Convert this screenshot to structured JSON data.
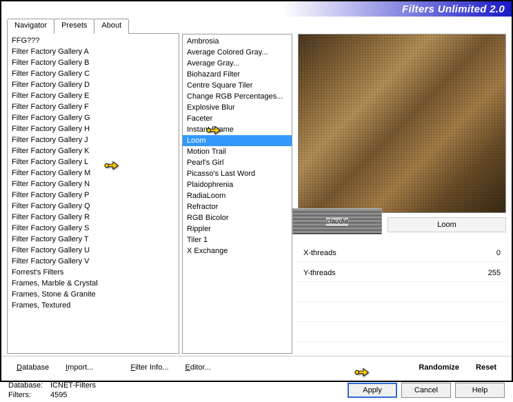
{
  "title": "Filters Unlimited 2.0",
  "tabs": [
    {
      "label": "Navigator",
      "active": true
    },
    {
      "label": "Presets",
      "active": false
    },
    {
      "label": "About",
      "active": false
    }
  ],
  "galleries": [
    "FFG???",
    "Filter Factory Gallery A",
    "Filter Factory Gallery B",
    "Filter Factory Gallery C",
    "Filter Factory Gallery D",
    "Filter Factory Gallery E",
    "Filter Factory Gallery F",
    "Filter Factory Gallery G",
    "Filter Factory Gallery H",
    "Filter Factory Gallery J",
    "Filter Factory Gallery K",
    "Filter Factory Gallery L",
    "Filter Factory Gallery M",
    "Filter Factory Gallery N",
    "Filter Factory Gallery P",
    "Filter Factory Gallery Q",
    "Filter Factory Gallery R",
    "Filter Factory Gallery S",
    "Filter Factory Gallery T",
    "Filter Factory Gallery U",
    "Filter Factory Gallery V",
    "Forrest's Filters",
    "Frames, Marble & Crystal",
    "Frames, Stone & Granite",
    "Frames, Textured"
  ],
  "galleries_selected_index": 12,
  "filters": [
    "Ambrosia",
    "Average Colored Gray...",
    "Average Gray...",
    "Biohazard Filter",
    "Centre Square Tiler",
    "Change RGB Percentages...",
    "Explosive Blur",
    "Faceter",
    "Instant Frame",
    "Loom",
    "Motion Trail",
    "Pearl's Girl",
    "Picasso's Last Word",
    "Plaidophrenia",
    "RadiaLoom",
    "Refractor",
    "RGB Bicolor",
    "Rippler",
    "Tiler 1",
    "X Exchange"
  ],
  "filters_selected_index": 9,
  "selected_filter_name": "Loom",
  "watermark": "claudia",
  "params": [
    {
      "label": "X-threads",
      "value": "0"
    },
    {
      "label": "Y-threads",
      "value": "255"
    }
  ],
  "bottom_buttons": {
    "database": "Database",
    "import": "Import...",
    "filter_info": "Filter Info...",
    "editor": "Editor...",
    "randomize": "Randomize",
    "reset": "Reset"
  },
  "status": {
    "db_label": "Database:",
    "db_value": "ICNET-Filters",
    "filters_label": "Filters:",
    "filters_value": "4595"
  },
  "action_buttons": {
    "apply": "Apply",
    "cancel": "Cancel",
    "help": "Help"
  }
}
